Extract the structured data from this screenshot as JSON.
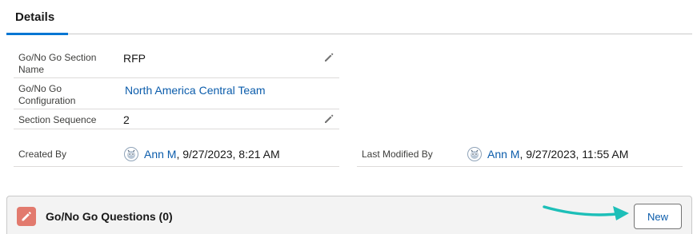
{
  "tabs": {
    "details_label": "Details"
  },
  "fields": {
    "section_name": {
      "label": "Go/No Go Section Name",
      "value": "RFP"
    },
    "configuration": {
      "label": "Go/No Go Configuration",
      "value": "North America Central Team"
    },
    "sequence": {
      "label": "Section Sequence",
      "value": "2"
    },
    "created_by": {
      "label": "Created By",
      "user": "Ann M",
      "date": ", 9/27/2023, 8:21 AM"
    },
    "last_modified_by": {
      "label": "Last Modified By",
      "user": "Ann M",
      "date": ", 9/27/2023, 11:55 AM"
    }
  },
  "related_list": {
    "title": "Go/No Go Questions (0)",
    "new_button_label": "New",
    "icon": "pencil-icon",
    "icon_color": "#e27a6e"
  },
  "colors": {
    "accent": "#0176d3",
    "link": "#0b5cab",
    "annotation_arrow": "#1dbfb8"
  }
}
